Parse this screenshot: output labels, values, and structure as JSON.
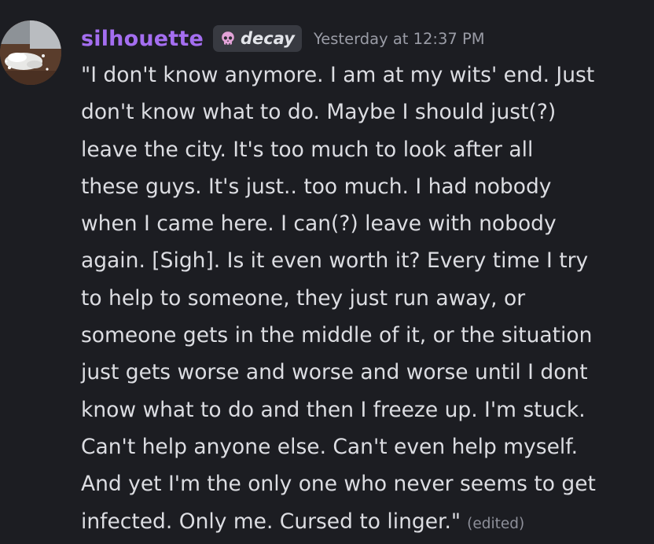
{
  "message": {
    "username": "silhouette",
    "username_color": "#a46ef0",
    "tag": {
      "icon": "skull-icon",
      "label": "decay"
    },
    "timestamp": "Yesterday at 12:37 PM",
    "content": "\"I don't know anymore. I am at my wits' end. Just\ndon't know what to do. Maybe I should just(?)\nleave the city. It's too much to look after all\nthese guys. It's just.. too much. I had nobody\nwhen I came here. I can(?) leave with nobody\nagain. [Sigh]. Is it even worth it? Every time I try\nto help to someone, they just run away, or\nsomeone gets in the middle of it, or the situation\njust gets worse and worse and worse until I dont\nknow what to do and then I freeze up. I'm stuck.\nCan't help anyone else. Can't even help myself.\nAnd yet I'm the only one who never seems to get\ninfected. Only me. Cursed to linger.\"",
    "edited_label": "(edited)"
  }
}
